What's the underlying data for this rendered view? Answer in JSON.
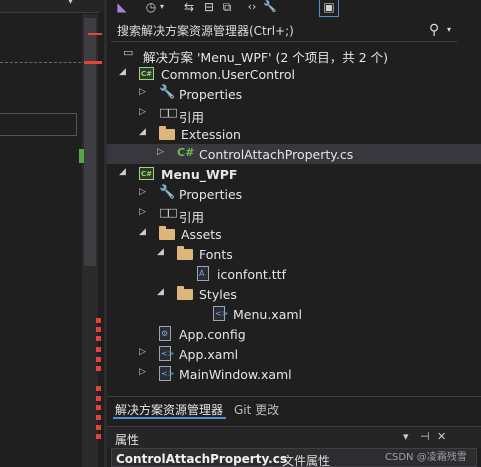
{
  "search": {
    "placeholder": "搜索解决方案资源管理器(Ctrl+;)"
  },
  "toolbar": {
    "icons": [
      "vs-icon",
      "history-icon",
      "sync-icon",
      "collapse-all-icon",
      "show-all-files-icon",
      "code-view-icon",
      "properties-wrench-icon",
      "preview-icon"
    ],
    "glyphs": {
      "vs": "◣",
      "history": "◷",
      "sync": "⇆",
      "collapse": "⊟",
      "show_all": "⧉",
      "code": "‹›",
      "wrench": "🔧",
      "preview": "▣"
    }
  },
  "tree": {
    "solution": "解决方案 'Menu_WPF' (2 个项目，共 2 个)",
    "common_project": "Common.UserControl",
    "common_properties": "Properties",
    "common_references": "引用",
    "extension_folder": "Extession",
    "control_file": "ControlAttachProperty.cs",
    "menu_project": "Menu_WPF",
    "menu_properties": "Properties",
    "menu_references": "引用",
    "assets_folder": "Assets",
    "fonts_folder": "Fonts",
    "font_file": "iconfont.ttf",
    "styles_folder": "Styles",
    "menu_xaml": "Menu.xaml",
    "app_config": "App.config",
    "app_xaml": "App.xaml",
    "mainwindow_xaml": "MainWindow.xaml",
    "cs_badge": "C#",
    "proj_badge": "C#"
  },
  "tabs": {
    "solution_explorer": "解决方案资源管理器",
    "git_changes": "Git 更改"
  },
  "properties": {
    "title": "属性",
    "object_name": "ControlAttachProperty.cs",
    "object_type": "文件属性",
    "pin_glyph": "⊣",
    "dropdown_glyph": "▾",
    "close_glyph": "✕"
  },
  "watermark": "CSDN @凌霜残雪",
  "colors": {
    "background": "#1f1f1f",
    "selection": "#37373d",
    "accent_tab": "#4e8fd6",
    "folder": "#dcb67a",
    "csharp": "#6bbf4a",
    "change_mark_red": "#e8403a",
    "change_mark_green": "#57a64a"
  }
}
